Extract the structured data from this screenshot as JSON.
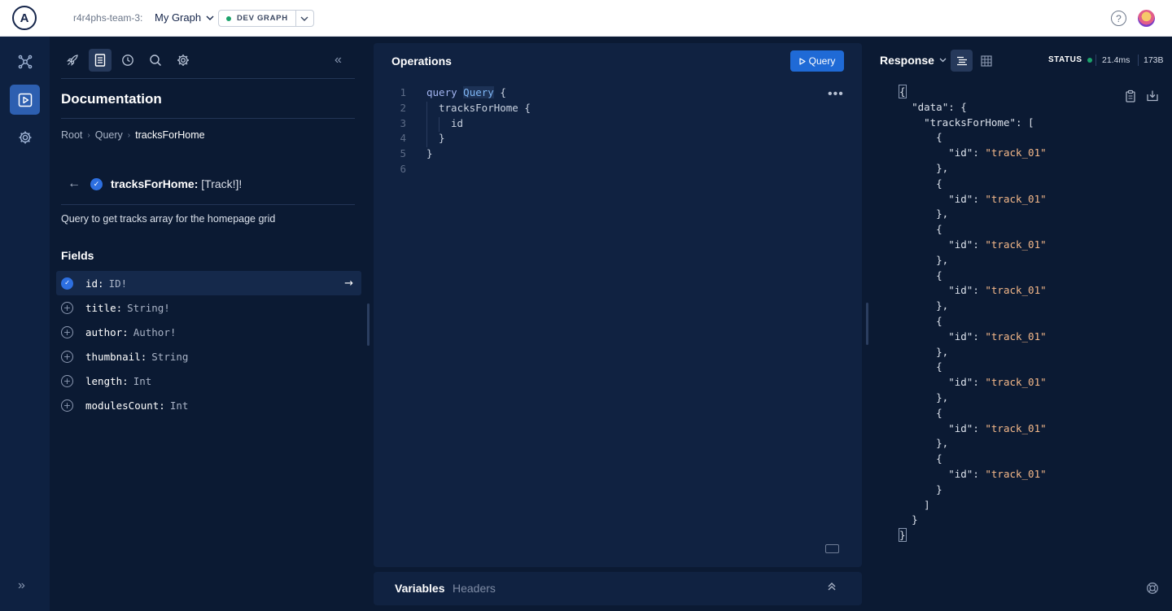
{
  "topbar": {
    "logo_letter": "A",
    "org": "r4r4phs-team-3:",
    "graph": "My Graph",
    "variant": "DEV GRAPH"
  },
  "docs": {
    "title": "Documentation",
    "breadcrumb": [
      "Root",
      "Query",
      "tracksForHome"
    ],
    "field": {
      "name": "tracksForHome:",
      "type": "[Track!]!"
    },
    "description": "Query to get tracks array for the homepage grid",
    "fields_label": "Fields",
    "fields": [
      {
        "name": "id:",
        "type": "ID!",
        "selected": true
      },
      {
        "name": "title:",
        "type": "String!",
        "selected": false
      },
      {
        "name": "author:",
        "type": "Author!",
        "selected": false
      },
      {
        "name": "thumbnail:",
        "type": "String",
        "selected": false
      },
      {
        "name": "length:",
        "type": "Int",
        "selected": false
      },
      {
        "name": "modulesCount:",
        "type": "Int",
        "selected": false
      }
    ]
  },
  "operations": {
    "title": "Operations",
    "run_label": "Query",
    "line_numbers": [
      "1",
      "2",
      "3",
      "4",
      "5",
      "6"
    ],
    "code": {
      "l1_keyword": "query",
      "l1_name": "Query",
      "l1_rest": " {",
      "l2": "tracksForHome {",
      "l3": "id",
      "l4": "}",
      "l5": "}"
    }
  },
  "bottom_tabs": {
    "variables": "Variables",
    "headers": "Headers"
  },
  "response": {
    "title": "Response",
    "status_label": "STATUS",
    "time": "21.4ms",
    "size": "173B",
    "data_key": "\"data\": {",
    "tracks_key": "\"tracksForHome\": [",
    "id_key": "\"id\": ",
    "track_value": "\"track_01\"",
    "item_count": 8
  },
  "colors": {
    "accent": "#1f6ad6",
    "status_ok": "#1ca36b",
    "background": "#0b1a33"
  }
}
